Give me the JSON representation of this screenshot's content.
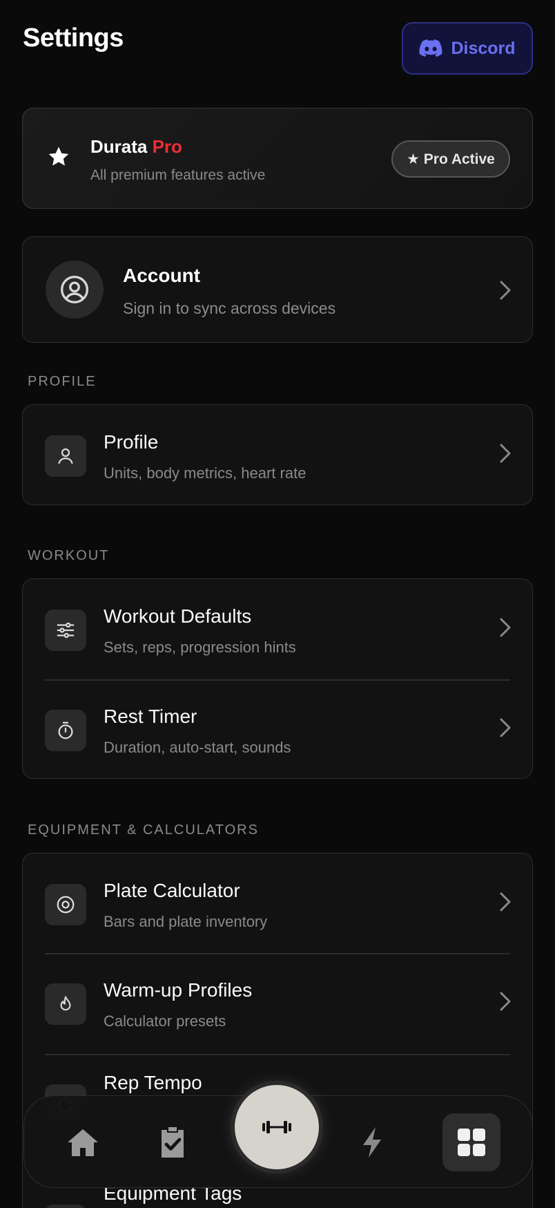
{
  "header": {
    "title": "Settings",
    "discord_label": "Discord"
  },
  "pro_card": {
    "name": "Durata",
    "pro_word": "Pro",
    "subtitle": "All premium features active",
    "badge": "★ Pro Active"
  },
  "account": {
    "title": "Account",
    "subtitle": "Sign in to sync across devices"
  },
  "sections": {
    "profile": "PROFILE",
    "workout": "WORKOUT",
    "equipment": "EQUIPMENT & CALCULATORS"
  },
  "profile_items": [
    {
      "title": "Profile",
      "subtitle": "Units, body metrics, heart rate",
      "icon": "user-icon"
    }
  ],
  "workout_items": [
    {
      "title": "Workout Defaults",
      "subtitle": "Sets, reps, progression hints",
      "icon": "sliders-icon"
    },
    {
      "title": "Rest Timer",
      "subtitle": "Duration, auto-start, sounds",
      "icon": "stopwatch-icon"
    }
  ],
  "equipment_items": [
    {
      "title": "Plate Calculator",
      "subtitle": "Bars and plate inventory",
      "icon": "target-icon"
    },
    {
      "title": "Warm-up Profiles",
      "subtitle": "Calculator presets",
      "icon": "flame-icon"
    },
    {
      "title": "Rep Tempo",
      "subtitle": "",
      "icon": "tempo-icon"
    },
    {
      "title": "Equipment Tags",
      "subtitle": "",
      "icon": "tag-icon"
    }
  ],
  "bottom_nav": {
    "items": [
      "home-icon",
      "clipboard-check-icon",
      "dumbbell-icon",
      "lightning-icon",
      "grid-icon"
    ],
    "active": "grid-icon"
  },
  "colors": {
    "accent_pro": "#ee2e34",
    "discord": "#6a70f2",
    "background": "#0a0a0a"
  }
}
